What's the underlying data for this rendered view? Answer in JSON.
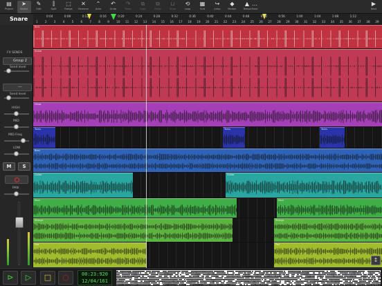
{
  "toolbar": {
    "items": [
      {
        "label": "Project",
        "icon": "folder-icon",
        "glyph": "▤"
      },
      {
        "label": "Select",
        "icon": "pointer-icon",
        "glyph": "➤",
        "active": true
      },
      {
        "label": "Edit",
        "icon": "edit-icon",
        "glyph": "✎"
      },
      {
        "label": "Split",
        "icon": "split-icon",
        "glyph": "⫿"
      },
      {
        "label": "Range",
        "icon": "range-icon",
        "glyph": "⬚"
      },
      {
        "label": "Remove",
        "icon": "remove-icon",
        "glyph": "✕"
      },
      {
        "label": "Auto",
        "icon": "automation-icon",
        "glyph": "⌃"
      },
      {
        "label": "Undo",
        "icon": "undo-icon",
        "glyph": "↶"
      },
      {
        "label": "Redo",
        "icon": "redo-icon",
        "glyph": "↷",
        "dim": true
      },
      {
        "label": "Copy",
        "icon": "copy-icon",
        "glyph": "⧉",
        "dim": true
      },
      {
        "label": "Paste",
        "icon": "paste-icon",
        "glyph": "⧉",
        "dim": true
      },
      {
        "label": "Snap",
        "icon": "snap-icon",
        "glyph": "⊔",
        "dim": true
      },
      {
        "label": "Loop",
        "icon": "loop-icon",
        "glyph": "⟲"
      },
      {
        "label": "Grid",
        "icon": "grid-icon",
        "glyph": "▦"
      },
      {
        "label": "Jump",
        "icon": "jump-icon",
        "glyph": "↪"
      },
      {
        "label": "Marker",
        "icon": "marker-icon",
        "glyph": "◆"
      },
      {
        "label": "Tempo",
        "icon": "metronome-icon",
        "glyph": "▲"
      },
      {
        "label": "More",
        "icon": "more-icon",
        "glyph": "…"
      },
      {
        "label": "Next",
        "icon": "next-icon",
        "glyph": "▶"
      }
    ]
  },
  "track_title": "Snare",
  "left_panel": {
    "fx_sends": "FX SENDS",
    "group_label": "Group 2",
    "send_level": "Send level",
    "none_label": "---",
    "high": "HIGH",
    "mid": "MID",
    "mid_freq": "MID Freq",
    "low": "LOW",
    "mute": "M",
    "solo": "S",
    "pan": "PAN"
  },
  "ruler": {
    "bars": [
      "1",
      "2",
      "3",
      "4",
      "5",
      "6",
      "7",
      "8",
      "9",
      "10",
      "11",
      "12",
      "13",
      "14",
      "15",
      "16",
      "17",
      "18",
      "19",
      "20",
      "21",
      "22",
      "23",
      "24",
      "25",
      "26",
      "27",
      "28",
      "29",
      "30",
      "31",
      "32",
      "33",
      "34",
      "35",
      "36",
      "37",
      "38",
      "39"
    ],
    "times": [
      "0:04",
      "0:08",
      "0:12",
      "0:16",
      "0:20",
      "0:24",
      "0:28",
      "0:32",
      "0:36",
      "0:40",
      "0:44",
      "0:48",
      "0:52",
      "0:56",
      "1:00",
      "1:04",
      "1:08",
      "1:12"
    ]
  },
  "tracks": [
    {
      "name": "Kick",
      "color": "#c0323f",
      "wave": "#e6e6e6"
    },
    {
      "name": "Snare",
      "color": "#c03a55",
      "wave": "#111111"
    },
    {
      "name": "Hihat",
      "color": "#a53fb7",
      "wave": "#111111"
    },
    {
      "name": "Toms",
      "color": "#2a34a8",
      "wave": "#111111"
    },
    {
      "name": "Bass",
      "color": "#2f63b8",
      "wave": "#111111"
    },
    {
      "name": "Guitar",
      "color": "#2aa6a0",
      "wave": "#111111"
    },
    {
      "name": "Keys",
      "color": "#3fae46",
      "wave": "#111111"
    },
    {
      "name": "Strings",
      "color": "#5db340",
      "wave": "#111111"
    },
    {
      "name": "Pad",
      "color": "#9fbd2c",
      "wave": "#111111"
    }
  ],
  "transport": {
    "time": "00:23:920",
    "position": "12/04/161",
    "play_icon": "play-icon",
    "record_icon": "record-icon"
  }
}
